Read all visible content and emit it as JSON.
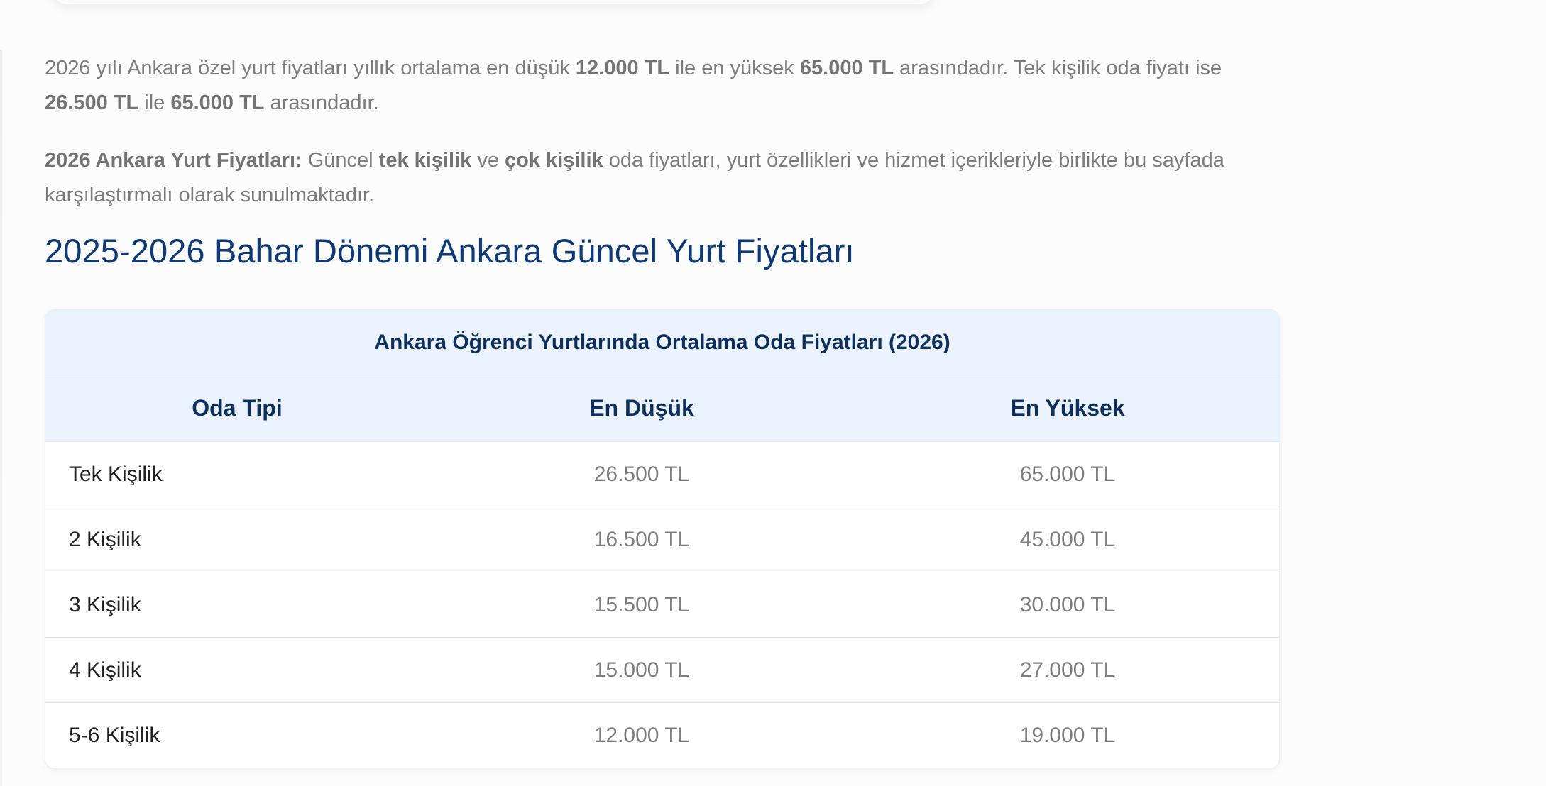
{
  "intro": {
    "p1": {
      "t1": "2026 yılı Ankara özel yurt fiyatları yıllık ortalama en düşük ",
      "b1": "12.000 TL",
      "t2": " ile en yüksek ",
      "b2": "65.000 TL",
      "t3": " arasındadır. Tek kişilik oda fiyatı ise ",
      "b3": "26.500 TL",
      "t4": " ile ",
      "b4": "65.000 TL",
      "t5": " arasındadır."
    },
    "p2": {
      "b1": "2026 Ankara Yurt Fiyatları:",
      "t1": " Güncel ",
      "b2": "tek kişilik",
      "t2": " ve ",
      "b3": "çok kişilik",
      "t3": " oda fiyatları, yurt özellikleri ve hizmet içerikleriyle birlikte bu sayfada karşılaştırmalı olarak sunulmaktadır."
    }
  },
  "heading": "2025-2026 Bahar Dönemi Ankara Güncel Yurt Fiyatları",
  "table": {
    "caption": "Ankara Öğrenci Yurtlarında Ortalama Oda Fiyatları (2026)",
    "columns": [
      "Oda Tipi",
      "En Düşük",
      "En Yüksek"
    ],
    "rows": [
      {
        "type": "Tek Kişilik",
        "min": "26.500 TL",
        "max": "65.000 TL"
      },
      {
        "type": "2 Kişilik",
        "min": "16.500 TL",
        "max": "45.000 TL"
      },
      {
        "type": "3 Kişilik",
        "min": "15.500 TL",
        "max": "30.000 TL"
      },
      {
        "type": "4 Kişilik",
        "min": "15.000 TL",
        "max": "27.000 TL"
      },
      {
        "type": "5-6 Kişilik",
        "min": "12.000 TL",
        "max": "19.000 TL"
      }
    ]
  },
  "colors": {
    "heading": "#0d3a77",
    "table_header_bg": "#eaf3fd",
    "table_header_text": "#0e2f5c"
  }
}
